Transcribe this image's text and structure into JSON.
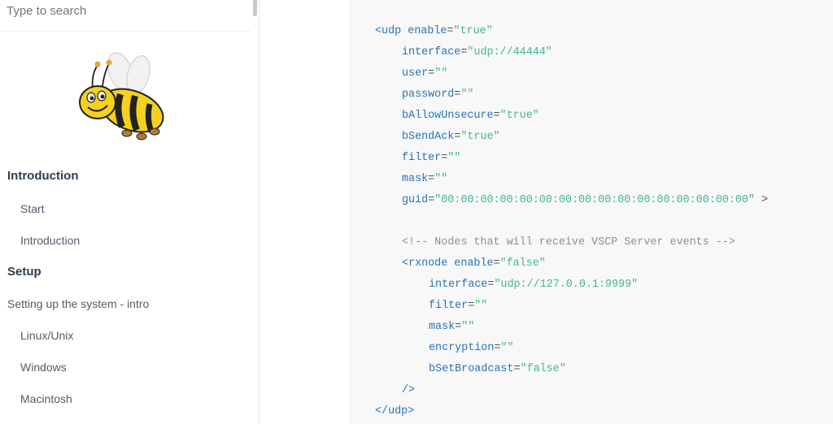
{
  "search": {
    "placeholder": "Type to search"
  },
  "logo": {
    "icon": "bee-mascot-icon"
  },
  "nav": {
    "items": [
      {
        "label": "Introduction",
        "kind": "section"
      },
      {
        "label": "Start",
        "kind": "sub"
      },
      {
        "label": "Introduction",
        "kind": "sub"
      },
      {
        "label": "Setup",
        "kind": "section"
      },
      {
        "label": "Setting up the system - intro",
        "kind": "link"
      },
      {
        "label": "Linux/Unix",
        "kind": "sub"
      },
      {
        "label": "Windows",
        "kind": "sub"
      },
      {
        "label": "Macintosh",
        "kind": "sub"
      }
    ]
  },
  "code": {
    "lines": [
      {
        "indent": 0,
        "parts": [
          [
            "tag",
            "<udp"
          ],
          [
            "punc",
            " "
          ],
          [
            "attr",
            "enable"
          ],
          [
            "eq",
            "="
          ],
          [
            "str",
            "\"true\""
          ]
        ]
      },
      {
        "indent": 1,
        "parts": [
          [
            "attr",
            "interface"
          ],
          [
            "eq",
            "="
          ],
          [
            "str",
            "\"udp://44444\""
          ]
        ]
      },
      {
        "indent": 1,
        "parts": [
          [
            "attr",
            "user"
          ],
          [
            "eq",
            "="
          ],
          [
            "str",
            "\"\""
          ]
        ]
      },
      {
        "indent": 1,
        "parts": [
          [
            "attr",
            "password"
          ],
          [
            "eq",
            "="
          ],
          [
            "str",
            "\"\""
          ]
        ]
      },
      {
        "indent": 1,
        "parts": [
          [
            "attr",
            "bAllowUnsecure"
          ],
          [
            "eq",
            "="
          ],
          [
            "str",
            "\"true\""
          ]
        ]
      },
      {
        "indent": 1,
        "parts": [
          [
            "attr",
            "bSendAck"
          ],
          [
            "eq",
            "="
          ],
          [
            "str",
            "\"true\""
          ]
        ]
      },
      {
        "indent": 1,
        "parts": [
          [
            "attr",
            "filter"
          ],
          [
            "eq",
            "="
          ],
          [
            "str",
            "\"\""
          ]
        ]
      },
      {
        "indent": 1,
        "parts": [
          [
            "attr",
            "mask"
          ],
          [
            "eq",
            "="
          ],
          [
            "str",
            "\"\""
          ]
        ]
      },
      {
        "indent": 1,
        "parts": [
          [
            "attr",
            "guid"
          ],
          [
            "eq",
            "="
          ],
          [
            "str",
            "\"00:00:00:00:00:00:00:00:00:00:00:00:00:00:00:00\""
          ],
          [
            "punc",
            " >"
          ]
        ]
      },
      {
        "indent": 0,
        "parts": []
      },
      {
        "indent": 1,
        "parts": [
          [
            "comment",
            "<!-- Nodes that will receive VSCP Server events -->"
          ]
        ]
      },
      {
        "indent": 1,
        "parts": [
          [
            "tag",
            "<rxnode"
          ],
          [
            "punc",
            " "
          ],
          [
            "attr",
            "enable"
          ],
          [
            "eq",
            "="
          ],
          [
            "str",
            "\"false\""
          ]
        ]
      },
      {
        "indent": 2,
        "parts": [
          [
            "attr",
            "interface"
          ],
          [
            "eq",
            "="
          ],
          [
            "str",
            "\"udp://127.0.0.1:9999\""
          ]
        ]
      },
      {
        "indent": 2,
        "parts": [
          [
            "attr",
            "filter"
          ],
          [
            "eq",
            "="
          ],
          [
            "str",
            "\"\""
          ]
        ]
      },
      {
        "indent": 2,
        "parts": [
          [
            "attr",
            "mask"
          ],
          [
            "eq",
            "="
          ],
          [
            "str",
            "\"\""
          ]
        ]
      },
      {
        "indent": 2,
        "parts": [
          [
            "attr",
            "encryption"
          ],
          [
            "eq",
            "="
          ],
          [
            "str",
            "\"\""
          ]
        ]
      },
      {
        "indent": 2,
        "parts": [
          [
            "attr",
            "bSetBroadcast"
          ],
          [
            "eq",
            "="
          ],
          [
            "str",
            "\"false\""
          ]
        ]
      },
      {
        "indent": 1,
        "parts": [
          [
            "tag",
            "/>"
          ]
        ]
      },
      {
        "indent": 0,
        "parts": [
          [
            "tag",
            "</udp>"
          ]
        ]
      }
    ]
  }
}
